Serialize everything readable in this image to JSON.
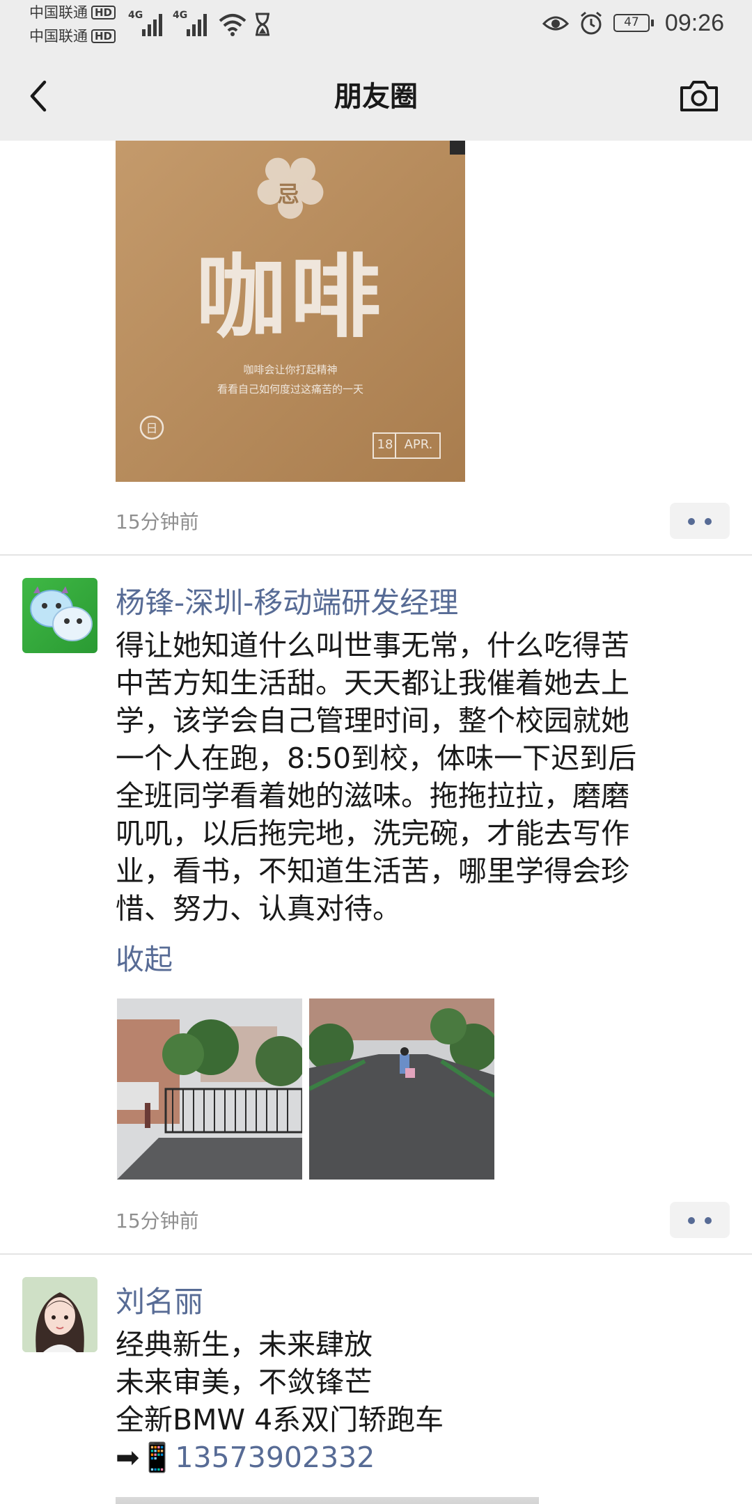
{
  "status": {
    "carrier1": "中国联通",
    "carrier2": "中国联通",
    "hd": "HD",
    "net1": "4G",
    "net2": "4G",
    "battery": "47",
    "time": "09:26"
  },
  "nav": {
    "title": "朋友圈"
  },
  "posts": [
    {
      "image": {
        "badge": "忌",
        "headline": "咖啡",
        "line1": "咖啡会让你打起精神",
        "line2": "看看自己如何度过这痛苦的一天",
        "day_badge": "日",
        "date_num": "18",
        "date_mon": "APR."
      },
      "time": "15分钟前"
    },
    {
      "author": "杨锋-深圳-移动端研发经理",
      "lines": [
        "得让她知道什么叫世事无常，什么吃得苦",
        "中苦方知生活甜。天天都让我催着她去上",
        "学，该学会自己管理时间，整个校园就她",
        "一个人在跑，8:50到校，体味一下迟到后",
        "全班同学看着她的滋味。拖拖拉拉，磨磨",
        "叽叽，以后拖完地，洗完碗，才能去写作",
        "业，看书，不知道生活苦，哪里学得会珍",
        "惜、努力、认真对待。"
      ],
      "fold": "收起",
      "time": "15分钟前"
    },
    {
      "author": "刘名丽",
      "lines": [
        "经典新生，未来肆放",
        "未来审美，不敛锋芒",
        "全新BMW 4系双门轿跑车"
      ],
      "phone_emoji": "➡📱",
      "phone": "13573902332"
    }
  ],
  "colors": {
    "link": "#576b95",
    "bar": "#ededed",
    "time": "#8f8f8f"
  }
}
